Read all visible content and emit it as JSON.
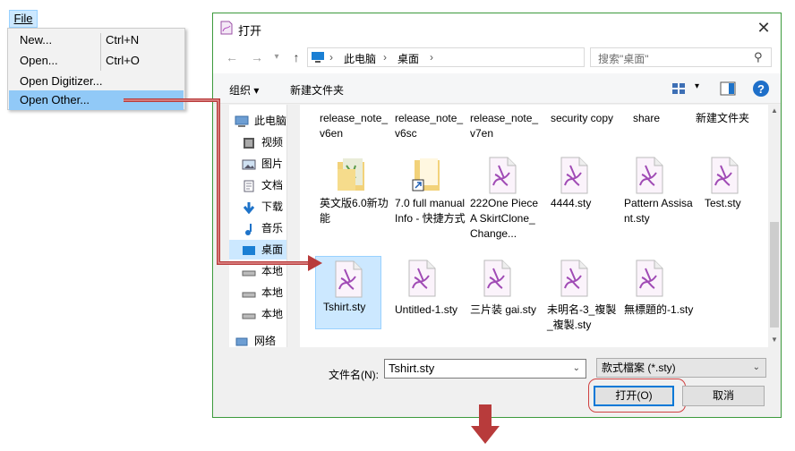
{
  "menu": {
    "file_tab": "File",
    "items": [
      {
        "label": "New...",
        "shortcut": "Ctrl+N"
      },
      {
        "label": "Open...",
        "shortcut": "Ctrl+O"
      },
      {
        "label": "Open Digitizer...",
        "shortcut": ""
      },
      {
        "label": "Open Other...",
        "shortcut": ""
      }
    ]
  },
  "dialog": {
    "title": "打开",
    "breadcrumb": [
      "此电脑",
      "桌面"
    ],
    "search_placeholder": "搜索\"桌面\"",
    "toolbar": {
      "organize": "组织 ▾",
      "new_folder": "新建文件夹"
    },
    "nav_items": [
      {
        "label": "此电脑",
        "icon": "computer-icon"
      },
      {
        "label": "视频",
        "icon": "video-icon"
      },
      {
        "label": "图片",
        "icon": "pictures-icon"
      },
      {
        "label": "文档",
        "icon": "documents-icon"
      },
      {
        "label": "下载",
        "icon": "download-icon"
      },
      {
        "label": "音乐",
        "icon": "music-icon"
      },
      {
        "label": "桌面",
        "icon": "desktop-icon"
      },
      {
        "label": "本地",
        "icon": "drive-icon"
      },
      {
        "label": "本地",
        "icon": "drive-icon"
      },
      {
        "label": "本地",
        "icon": "drive-icon"
      },
      {
        "label": "网络",
        "icon": "network-icon"
      }
    ],
    "files": [
      {
        "label": "release_note_v6en",
        "type": "partial"
      },
      {
        "label": "release_note_v6sc",
        "type": "partial"
      },
      {
        "label": "release_note_v7en",
        "type": "partial"
      },
      {
        "label": "security copy",
        "type": "partial"
      },
      {
        "label": "share",
        "type": "partial"
      },
      {
        "label": "新建文件夹",
        "type": "partial"
      },
      {
        "label": "英文版6.0新功能",
        "type": "folder"
      },
      {
        "label": "7.0 full manual Info - 快捷方式",
        "type": "shortcut"
      },
      {
        "label": "222One Piece A SkirtClone_Change...",
        "type": "sty"
      },
      {
        "label": "4444.sty",
        "type": "sty"
      },
      {
        "label": "Pattern Assisant.sty",
        "type": "sty"
      },
      {
        "label": "Test.sty",
        "type": "sty"
      },
      {
        "label": "Tshirt.sty",
        "type": "sty"
      },
      {
        "label": "Untitled-1.sty",
        "type": "sty"
      },
      {
        "label": "三片装 gai.sty",
        "type": "sty"
      },
      {
        "label": "未明名-3_複製_複製.sty",
        "type": "sty"
      },
      {
        "label": "無標題的-1.sty",
        "type": "sty"
      }
    ],
    "filename_label": "文件名(N):",
    "filename_value": "Tshirt.sty",
    "filetype": "款式檔案 (*.sty)",
    "open_button": "打开(O)",
    "cancel_button": "取消"
  },
  "colors": {
    "accent": "#0078d7",
    "highlight": "#cce8ff",
    "menu_selected": "#91c9f7",
    "arrow": "#b83b3b",
    "dialog_border": "#3c9a3c"
  }
}
